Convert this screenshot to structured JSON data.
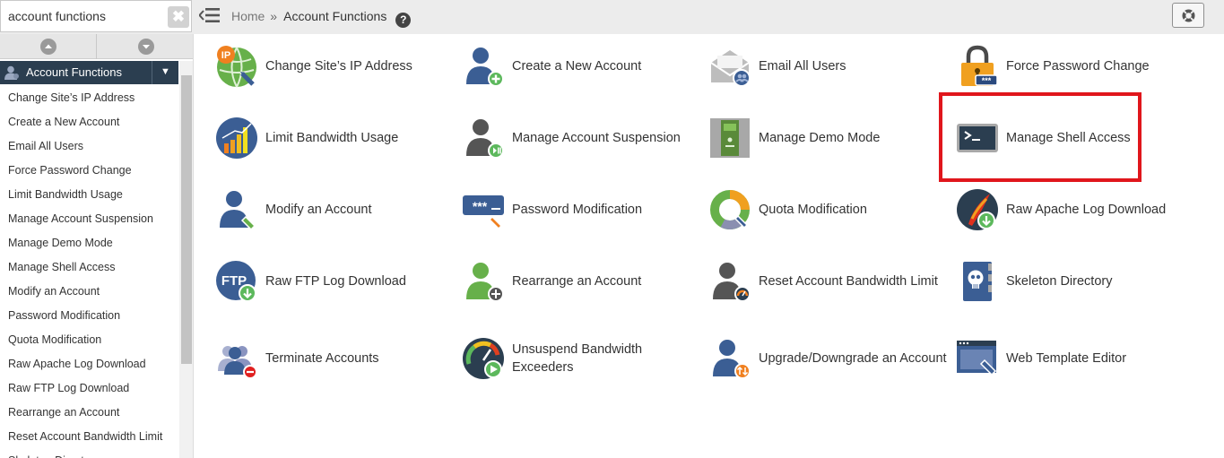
{
  "search": {
    "value": "account functions",
    "clear_glyph": "✖"
  },
  "breadcrumb": {
    "home": "Home",
    "separator": "»",
    "current": "Account Functions",
    "help": "?"
  },
  "sidebar": {
    "category": "Account Functions",
    "caret": "▼",
    "items": [
      "Change Site’s IP Address",
      "Create a New Account",
      "Email All Users",
      "Force Password Change",
      "Limit Bandwidth Usage",
      "Manage Account Suspension",
      "Manage Demo Mode",
      "Manage Shell Access",
      "Modify an Account",
      "Password Modification",
      "Quota Modification",
      "Raw Apache Log Download",
      "Raw FTP Log Download",
      "Rearrange an Account",
      "Reset Account Bandwidth Limit",
      "Skeleton Directory"
    ]
  },
  "tiles": [
    {
      "label": "Change Site’s IP Address",
      "icon": "ip-globe-icon"
    },
    {
      "label": "Create a New Account",
      "icon": "user-add-icon"
    },
    {
      "label": "Email All Users",
      "icon": "email-icon"
    },
    {
      "label": "Force Password Change",
      "icon": "padlock-icon"
    },
    {
      "label": "Limit Bandwidth Usage",
      "icon": "bandwidth-chart-icon"
    },
    {
      "label": "Manage Account Suspension",
      "icon": "user-suspend-icon"
    },
    {
      "label": "Manage Demo Mode",
      "icon": "demo-mode-icon"
    },
    {
      "label": "Manage Shell Access",
      "icon": "terminal-icon"
    },
    {
      "label": "Modify an Account",
      "icon": "user-edit-icon"
    },
    {
      "label": "Password Modification",
      "icon": "password-icon"
    },
    {
      "label": "Quota Modification",
      "icon": "quota-icon"
    },
    {
      "label": "Raw Apache Log Download",
      "icon": "apache-log-icon"
    },
    {
      "label": "Raw FTP Log Download",
      "icon": "ftp-log-icon"
    },
    {
      "label": "Rearrange an Account",
      "icon": "user-move-icon"
    },
    {
      "label": "Reset Account Bandwidth Limit",
      "icon": "user-gauge-icon"
    },
    {
      "label": "Skeleton Directory",
      "icon": "skeleton-icon"
    },
    {
      "label": "Terminate Accounts",
      "icon": "users-remove-icon"
    },
    {
      "label": "Unsuspend Bandwidth Exceeders",
      "icon": "gauge-play-icon"
    },
    {
      "label": "Upgrade/Downgrade an Account",
      "icon": "user-upgrade-icon"
    },
    {
      "label": "Web Template Editor",
      "icon": "web-template-icon"
    }
  ],
  "highlighted_tile": "Manage Shell Access",
  "colors": {
    "nav_dark": "#2b3e50",
    "highlight": "#e0161c",
    "icon_blue": "#3b5e94",
    "icon_green": "#5cb85c",
    "icon_orange": "#f08020"
  }
}
